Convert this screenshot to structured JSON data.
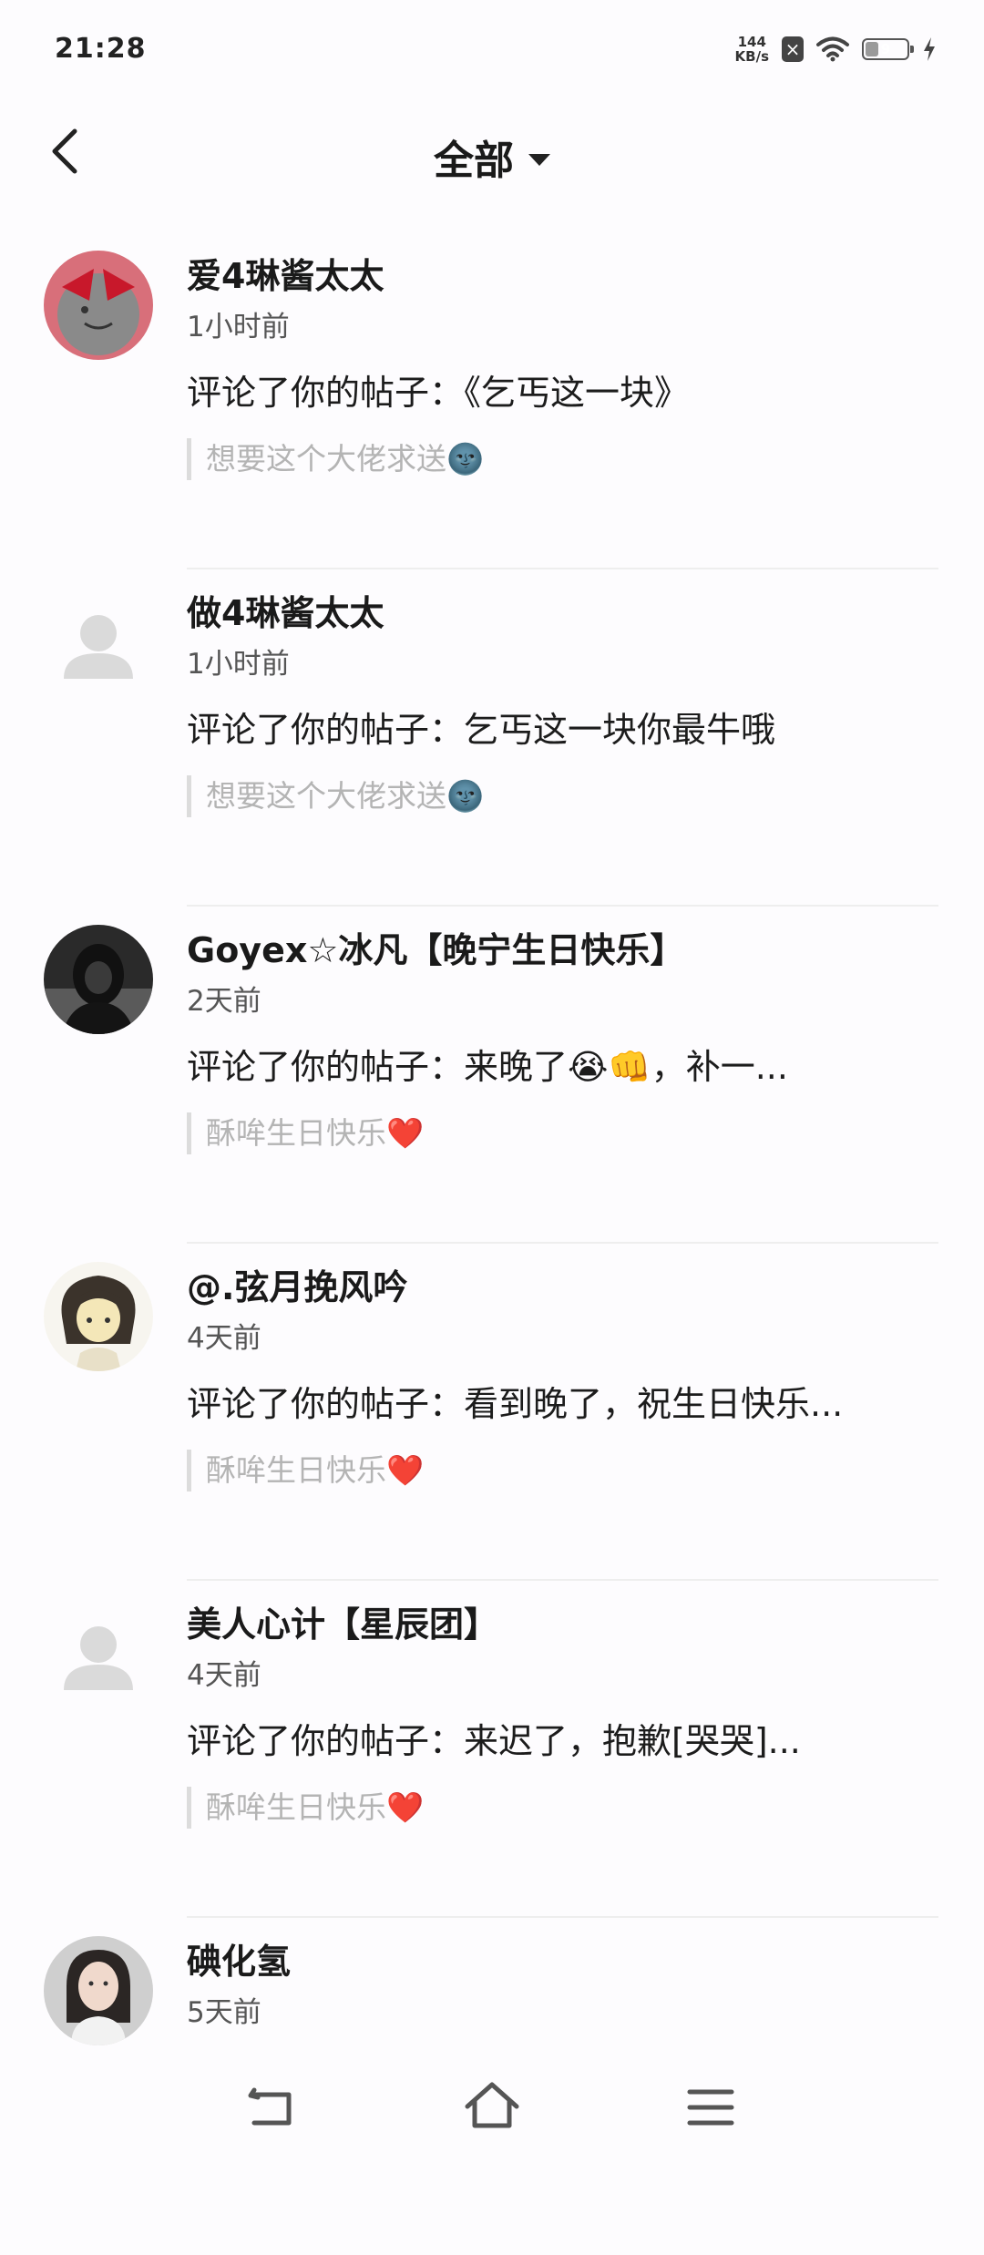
{
  "status_bar": {
    "time": "21:28",
    "net_speed_value": "144",
    "net_speed_unit": "KB/s",
    "notification_icon": "close-box-icon",
    "battery_level": "9"
  },
  "header": {
    "title": "全部"
  },
  "items": [
    {
      "name": "爱4琳酱太太",
      "time": "1小时前",
      "comment": "评论了你的帖子：《乞丐这一块》",
      "quote": "想要这个大佬求送🌚",
      "avatar": "red-gray-character"
    },
    {
      "name": "做4琳酱太太",
      "time": "1小时前",
      "comment": "评论了你的帖子：乞丐这一块你最牛哦",
      "quote": "想要这个大佬求送🌚",
      "avatar": "placeholder"
    },
    {
      "name": "Goyex☆冰凡【晚宁生日快乐】",
      "time": "2天前",
      "comment": "评论了你的帖子：来晚了😭👊，补一...",
      "quote": "酥哞生日快乐❤️",
      "avatar": "dark-hood"
    },
    {
      "name": "@.弦月挽风吟",
      "time": "4天前",
      "comment": "评论了你的帖子：看到晚了，祝生日快乐...",
      "quote": "酥哞生日快乐❤️",
      "avatar": "anime-girl"
    },
    {
      "name": "美人心计【星辰团】",
      "time": "4天前",
      "comment": "评论了你的帖子：来迟了，抱歉[哭哭]...",
      "quote": "酥哞生日快乐❤️",
      "avatar": "placeholder"
    },
    {
      "name": "碘化氢",
      "time": "5天前",
      "comment": "",
      "quote": "",
      "avatar": "portrait"
    }
  ],
  "colors": {
    "background": "#fdfcfe",
    "text_primary": "#1c1c1c",
    "text_secondary": "#555555",
    "quote_text": "#b4b4b4",
    "divider": "#eeeeee"
  }
}
